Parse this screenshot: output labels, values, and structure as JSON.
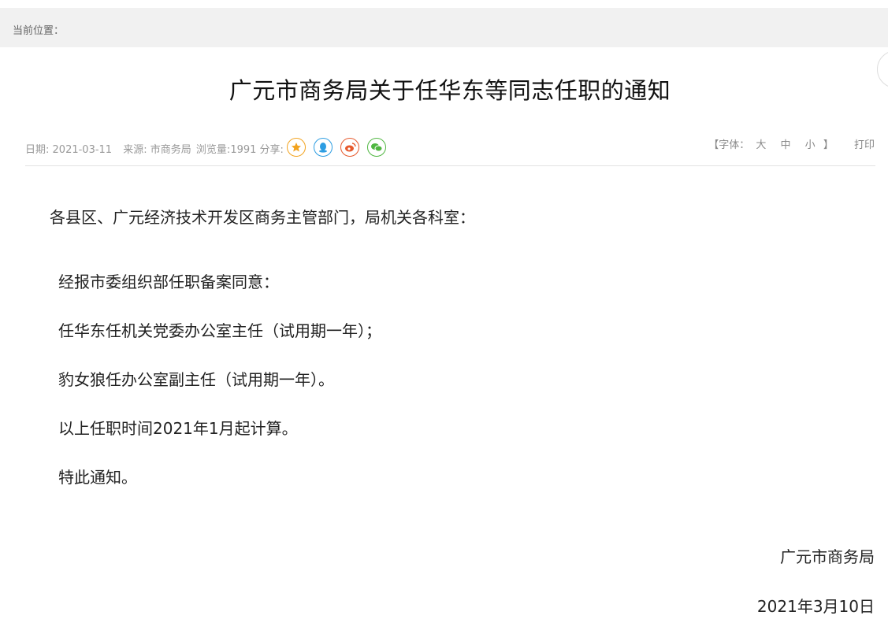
{
  "breadcrumb": {
    "label": "当前位置："
  },
  "article": {
    "title": "广元市商务局关于任华东等同志任职的通知",
    "meta": {
      "date_label": "日期:",
      "date": "2021-03-11",
      "source_label": "来源:",
      "source": "市商务局",
      "views_label": "浏览量:",
      "views": "1991",
      "share_label": "分享:"
    },
    "share_icons": [
      {
        "name": "qzone-icon",
        "color": "#f2a31f"
      },
      {
        "name": "qq-icon",
        "color": "#2d9de2"
      },
      {
        "name": "weibo-icon",
        "color": "#e6592c"
      },
      {
        "name": "wechat-icon",
        "color": "#4fb640"
      }
    ],
    "font_controls": {
      "prefix": "【字体：",
      "large": "大",
      "medium": "中",
      "small": "小",
      "suffix": "】",
      "print": "打印"
    },
    "salutation": "各县区、广元经济技术开发区商务主管部门，局机关各科室：",
    "paragraphs": [
      "经报市委组织部任职备案同意：",
      "任华东任机关党委办公室主任（试用期一年）；",
      "豹女狼任办公室副主任（试用期一年）。",
      "以上任职时间2021年1月起计算。",
      "特此通知。"
    ],
    "signature": {
      "org": "广元市商务局",
      "date": "2021年3月10日"
    }
  }
}
